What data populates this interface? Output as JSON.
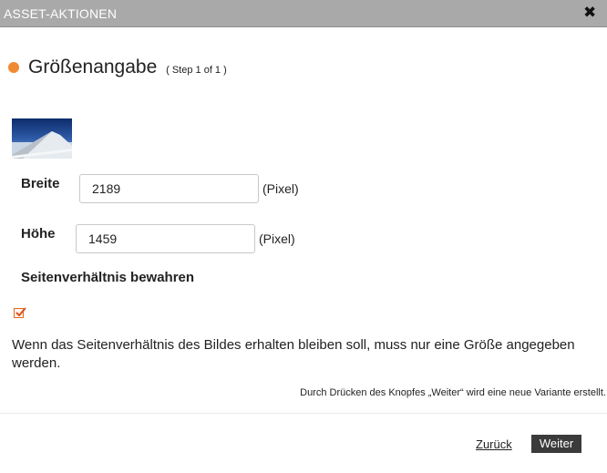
{
  "dialog": {
    "title": "ASSET-AKTIONEN",
    "close_icon": "close-icon",
    "accent_color": "#f08a30"
  },
  "step": {
    "title": "Größenangabe",
    "indicator": "( Step 1 of 1 )"
  },
  "form": {
    "width_label": "Breite",
    "width_value": "2189",
    "width_unit": "(Pixel)",
    "height_label": "Höhe",
    "height_value": "1459",
    "height_unit": "(Pixel)",
    "aspect_label": "Seitenverhältnis bewahren",
    "aspect_checked": true
  },
  "info_text": "Wenn das Seitenverhältnis des Bildes erhalten bleiben soll, muss nur eine Größe angegeben werden.",
  "note_text": "Durch Drücken des Knopfes „Weiter“ wird eine neue Variante erstellt.",
  "footer": {
    "back_label": "Zurück",
    "next_label": "Weiter"
  }
}
